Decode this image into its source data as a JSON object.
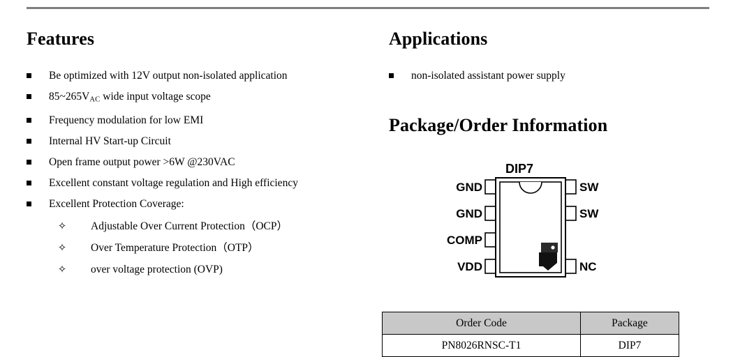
{
  "rule": {
    "color": "#7f7f7f"
  },
  "left": {
    "heading": "Features",
    "items": [
      {
        "text": "Be optimized with 12V output non-isolated application"
      },
      {
        "text_pre": "85~265V",
        "subscript": "AC",
        "text_post": " wide input voltage scope"
      },
      {
        "text": "Frequency modulation for low EMI"
      },
      {
        "text": "Internal HV Start-up Circuit"
      },
      {
        "text": "Open frame output power >6W @230VAC"
      },
      {
        "text": "Excellent constant voltage regulation and High efficiency"
      },
      {
        "text": "Excellent Protection Coverage:"
      }
    ],
    "sub_items": [
      {
        "text": "Adjustable Over Current Protection（OCP）"
      },
      {
        "text": "Over Temperature Protection（OTP）"
      },
      {
        "text": "over voltage protection (OVP)"
      }
    ],
    "bullet_glyph": "square-bullet",
    "sub_bullet_glyph": "✧"
  },
  "right": {
    "applications": {
      "heading": "Applications",
      "items": [
        {
          "text": "non-isolated assistant power supply"
        }
      ]
    },
    "package_order": {
      "heading": "Package/Order Information",
      "diagram": {
        "title": "DIP7",
        "pins_left": [
          "GND",
          "GND",
          "COMP",
          "VDD"
        ],
        "pins_right": [
          "SW",
          "SW",
          "NC"
        ],
        "body_color": "#ffffff",
        "line_color": "#000000",
        "logo_color": "#111111"
      },
      "table": {
        "headers": [
          "Order Code",
          "Package"
        ],
        "rows": [
          [
            "PN8026RNSC-T1",
            "DIP7"
          ]
        ],
        "header_bg": "#c8c8c8"
      }
    }
  }
}
